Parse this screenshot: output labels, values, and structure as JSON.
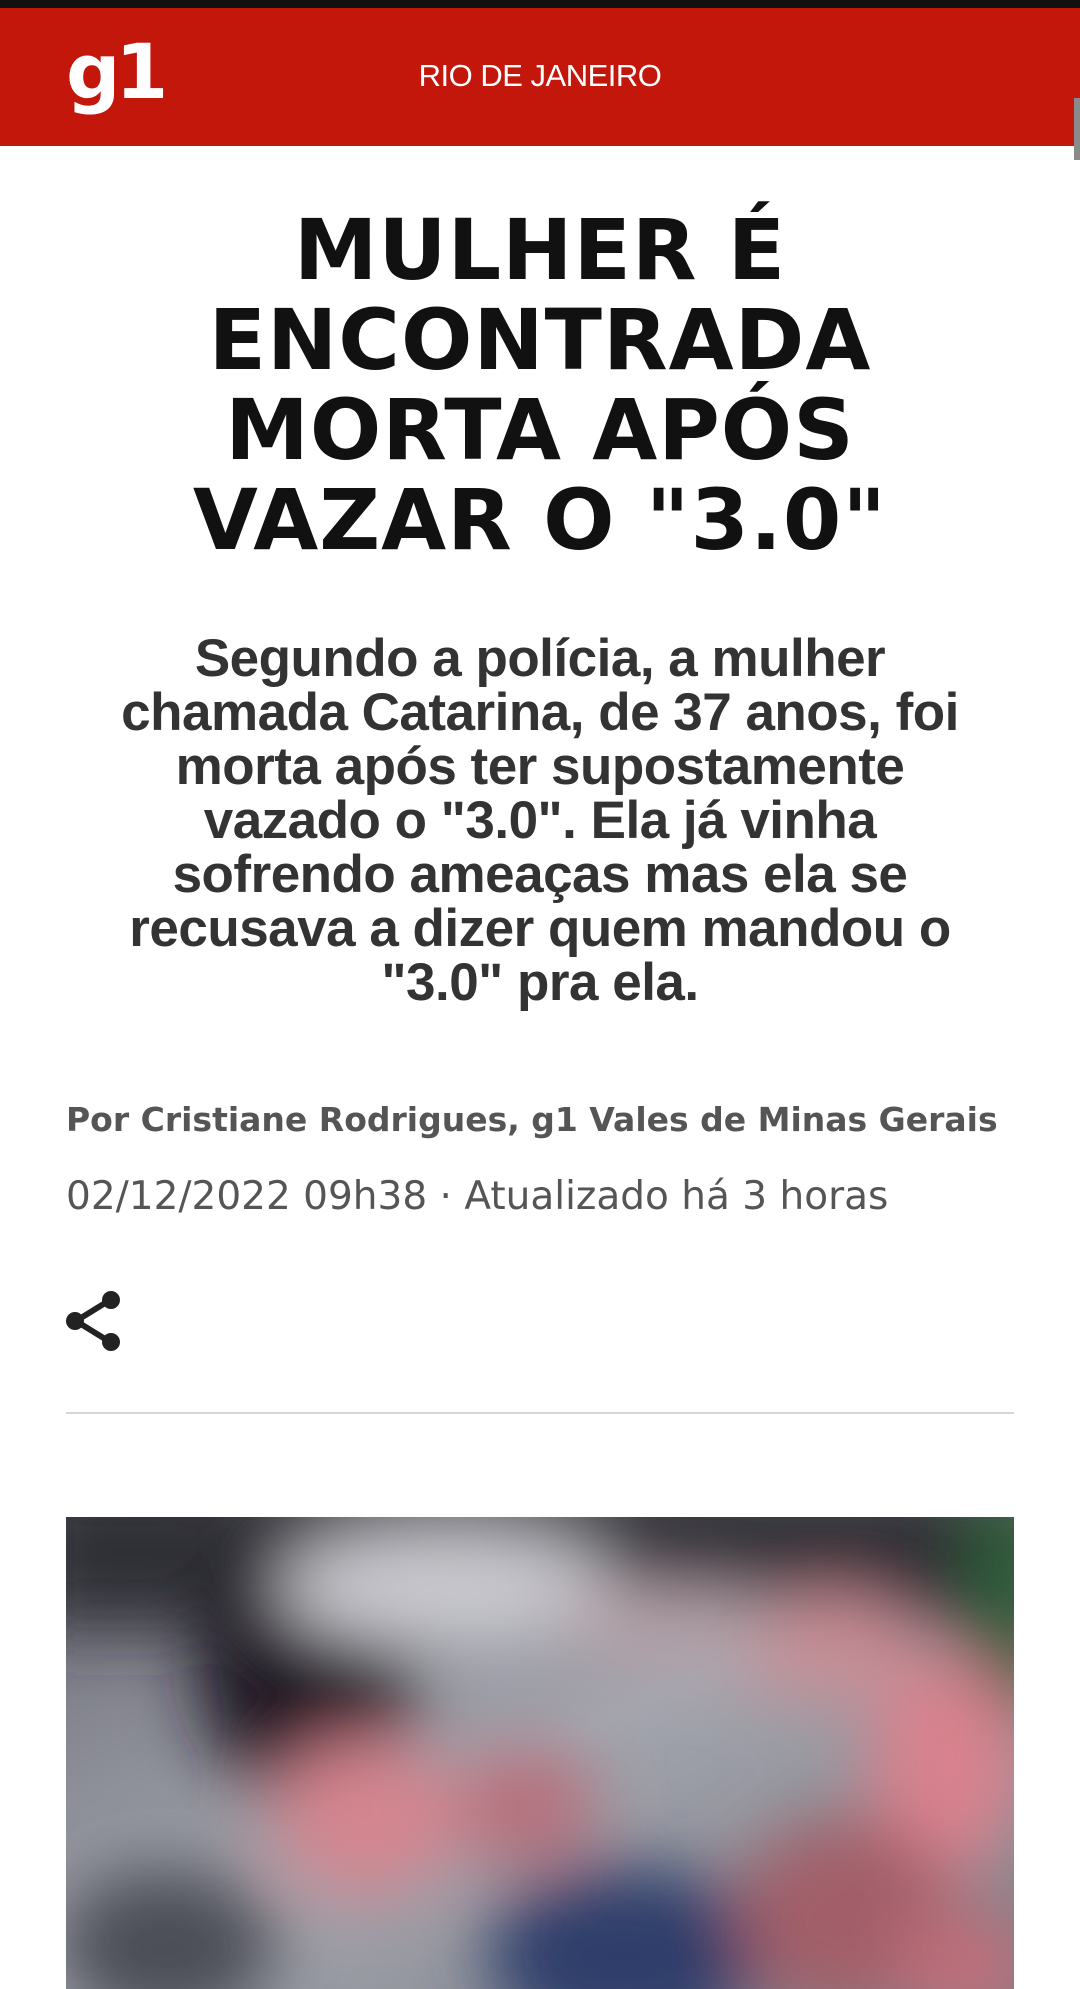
{
  "header": {
    "logo_text": "g1",
    "section": "RIO DE JANEIRO",
    "background_color": "#c4170c"
  },
  "article": {
    "headline": "MULHER É ENCONTRADA MORTA APÓS VAZAR O \"3.0\"",
    "subtitle": "Segundo a polícia, a mulher chamada Catarina, de 37 anos, foi morta após ter supostamente vazado o \"3.0\". Ela já vinha sofrendo ameaças mas ela se recusava a dizer quem mandou o \"3.0\" pra ela.",
    "byline": "Por Cristiane Rodrigues, g1 Vales de Minas Gerais",
    "dateline": "02/12/2022 09h38 · Atualizado há 3 horas",
    "share_icon": "share-icon",
    "image_description": "blurred-photo"
  }
}
